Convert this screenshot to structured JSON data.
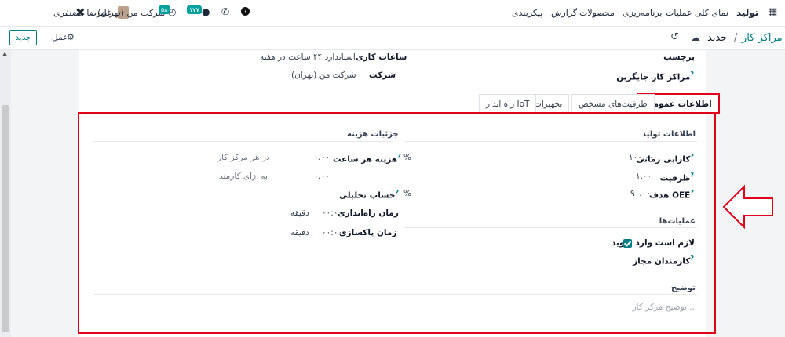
{
  "nav": {
    "app_name": "تولید",
    "menu": [
      "نمای کلی",
      "عملیات",
      "برنامه‌ریزی",
      "محصولات",
      "گزارش",
      "پیکربندی"
    ],
    "company": "شرکت من (تهران)",
    "user": "علیرضا غضنفری",
    "activity_badge": "۵۸",
    "messages_badge": "۱۷۷"
  },
  "control": {
    "breadcrumb_parent": "مراکز کار",
    "breadcrumb_sep": "/",
    "breadcrumb_current": "جدید",
    "action_label": "عمل",
    "new_label": "جدید"
  },
  "form": {
    "tag_label": "برچسب",
    "alt_label": "مراکز کار جایگزین",
    "hours_label": "ساعات کاری",
    "hours_value": "استاندارد ۴۴ ساعت در هفته",
    "company_label": "شرکت",
    "company_value": "شرکت من (تهران)"
  },
  "tabs": [
    "اطلاعات عمومی",
    "ظرفیت‌های مشخص",
    "تجهیزات",
    "راه انداز IoT"
  ],
  "production": {
    "title": "اطلاعات تولید",
    "efficiency_label": "کارایی زمانی",
    "efficiency_value": "۱۰۰.۰۰",
    "efficiency_unit": "%",
    "capacity_label": "ظرفیت",
    "capacity_value": "۱.۰۰",
    "oee_label": "هدف OEE",
    "oee_value": "۹۰.۰۰",
    "oee_unit": "%"
  },
  "cost": {
    "title": "جزئیات هزینه",
    "hourly_label": "هزینه هر ساعت",
    "hourly_value": "۰.۰۰",
    "hourly_note": "در هر مرکز کار",
    "employee_value": "۰.۰۰",
    "employee_note": "به ازای کارمند",
    "analytic_label": "حساب تحلیلی",
    "setup_label": "زمان راه‌اندازی",
    "setup_value": "۰۰:۰۰",
    "setup_unit": "دقیقه",
    "cleanup_label": "زمان پاکسازی",
    "cleanup_value": "۰۰:۰۰",
    "cleanup_unit": "دقیقه"
  },
  "operations": {
    "title": "عملیات‌ها",
    "login_label": "لازم است وارد شوید",
    "login_checked": true,
    "employees_label": "کارمندان مجاز"
  },
  "description": {
    "title": "توضیح",
    "placeholder": "توضیح مرکز کار..."
  },
  "colors": {
    "accent": "#017e84",
    "highlight": "#e0001a"
  }
}
